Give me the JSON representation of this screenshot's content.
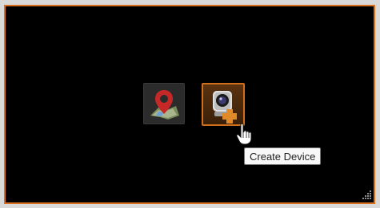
{
  "toolbar": {
    "buttons": [
      {
        "id": "map",
        "icon": "map-pin-icon",
        "state": "normal"
      },
      {
        "id": "create-device",
        "icon": "camera-add-icon",
        "state": "hover"
      }
    ]
  },
  "tooltip": {
    "text": "Create Device"
  },
  "colors": {
    "accent": "#d9701f",
    "background": "#000000",
    "pin": "#c62828"
  }
}
